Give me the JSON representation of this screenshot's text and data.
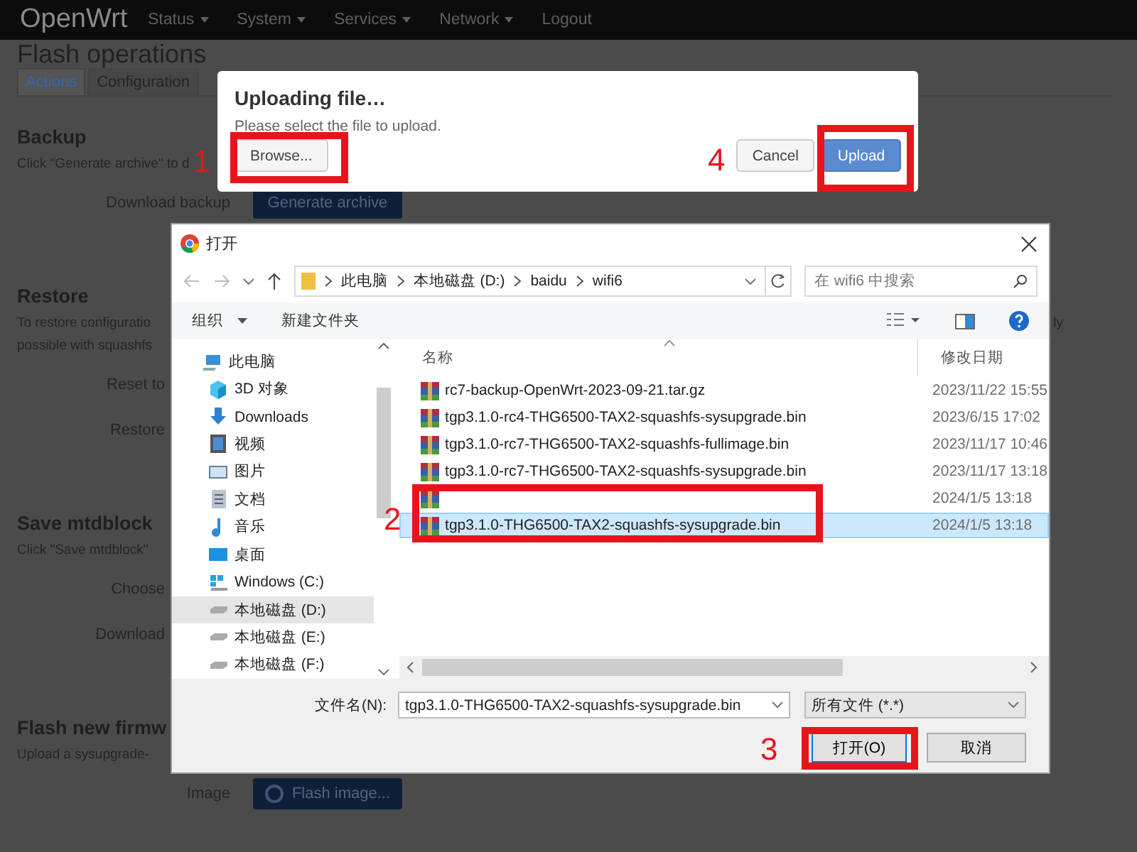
{
  "nav": {
    "brand": "OpenWrt",
    "menu": [
      {
        "label": "Status",
        "caret": true
      },
      {
        "label": "System",
        "caret": true
      },
      {
        "label": "Services",
        "caret": true
      },
      {
        "label": "Network",
        "caret": true
      },
      {
        "label": "Logout",
        "caret": false
      }
    ]
  },
  "page": {
    "title": "Flash operations",
    "tabs": [
      {
        "label": "Actions",
        "selected": true
      },
      {
        "label": "Configuration",
        "selected": false
      }
    ],
    "sections": [
      {
        "heading": "Backup",
        "lines": [
          "Click \"Generate archive\" to d"
        ],
        "fields": [
          {
            "label": "Download backup",
            "button": "Generate archive",
            "spinner": false
          }
        ]
      },
      {
        "heading": "Restore",
        "lines": [
          "To restore configuratio",
          "possible with squashfs"
        ],
        "tail": "ly",
        "fields": [
          {
            "label": "Reset to"
          },
          {
            "label": "Restore"
          }
        ]
      },
      {
        "heading": "Save mtdblock",
        "lines": [
          "Click \"Save mtdblock\""
        ],
        "fields": [
          {
            "label": "Choose"
          },
          {
            "label": "Download"
          }
        ]
      },
      {
        "heading": "Flash new firmw",
        "lines": [
          "Upload a sysupgrade-"
        ],
        "fields": [
          {
            "label": "Image",
            "button": "Flash image...",
            "spinner": true
          }
        ]
      }
    ]
  },
  "upload_modal": {
    "title": "Uploading file…",
    "text": "Please select the file to upload.",
    "browse": "Browse...",
    "cancel": "Cancel",
    "upload": "Upload"
  },
  "file_dialog": {
    "title": "打开",
    "path": [
      "此电脑",
      "本地磁盘 (D:)",
      "baidu",
      "wifi6"
    ],
    "search": {
      "placeholder": "在 wifi6 中搜索"
    },
    "toolbar": {
      "organize": "组织",
      "new_folder": "新建文件夹"
    },
    "nav_items": [
      {
        "label": "此电脑",
        "kind": "pc",
        "selected": false
      },
      {
        "label": "3D 对象",
        "kind": "cube",
        "selected": false
      },
      {
        "label": "Downloads",
        "kind": "download",
        "selected": false
      },
      {
        "label": "视频",
        "kind": "video",
        "selected": false
      },
      {
        "label": "图片",
        "kind": "picture",
        "selected": false
      },
      {
        "label": "文档",
        "kind": "document",
        "selected": false
      },
      {
        "label": "音乐",
        "kind": "music",
        "selected": false
      },
      {
        "label": "桌面",
        "kind": "desktop",
        "selected": false
      },
      {
        "label": "Windows (C:)",
        "kind": "windows",
        "selected": false
      },
      {
        "label": "本地磁盘 (D:)",
        "kind": "drive",
        "selected": true
      },
      {
        "label": "本地磁盘 (E:)",
        "kind": "drive",
        "selected": false
      },
      {
        "label": "本地磁盘 (F:)",
        "kind": "drive",
        "selected": false
      }
    ],
    "columns": [
      "名称",
      "修改日期"
    ],
    "files": [
      {
        "name": "rc7-backup-OpenWrt-2023-09-21.tar.gz",
        "date": "2023/11/22 15:55",
        "selected": false
      },
      {
        "name": "tgp3.1.0-rc4-THG6500-TAX2-squashfs-sysupgrade.bin",
        "date": "2023/6/15 17:02",
        "selected": false
      },
      {
        "name": "tgp3.1.0-rc7-THG6500-TAX2-squashfs-fullimage.bin",
        "date": "2023/11/17 10:46",
        "selected": false
      },
      {
        "name": "tgp3.1.0-rc7-THG6500-TAX2-squashfs-sysupgrade.bin",
        "date": "2023/11/17 13:18",
        "selected": false
      },
      {
        "date": "2024/1/5 13:18",
        "selected": false
      },
      {
        "name": "tgp3.1.0-THG6500-TAX2-squashfs-sysupgrade.bin",
        "date": "2024/1/5 13:18",
        "selected": true
      }
    ],
    "filename_label": "文件名(N):",
    "filename": "tgp3.1.0-THG6500-TAX2-squashfs-sysupgrade.bin",
    "filetype": "所有文件 (*.*)",
    "open": "打开(O)",
    "cancel": "取消"
  },
  "annotations": [
    {
      "number": "1"
    },
    {
      "number": "2"
    },
    {
      "number": "3"
    },
    {
      "number": "4"
    }
  ]
}
